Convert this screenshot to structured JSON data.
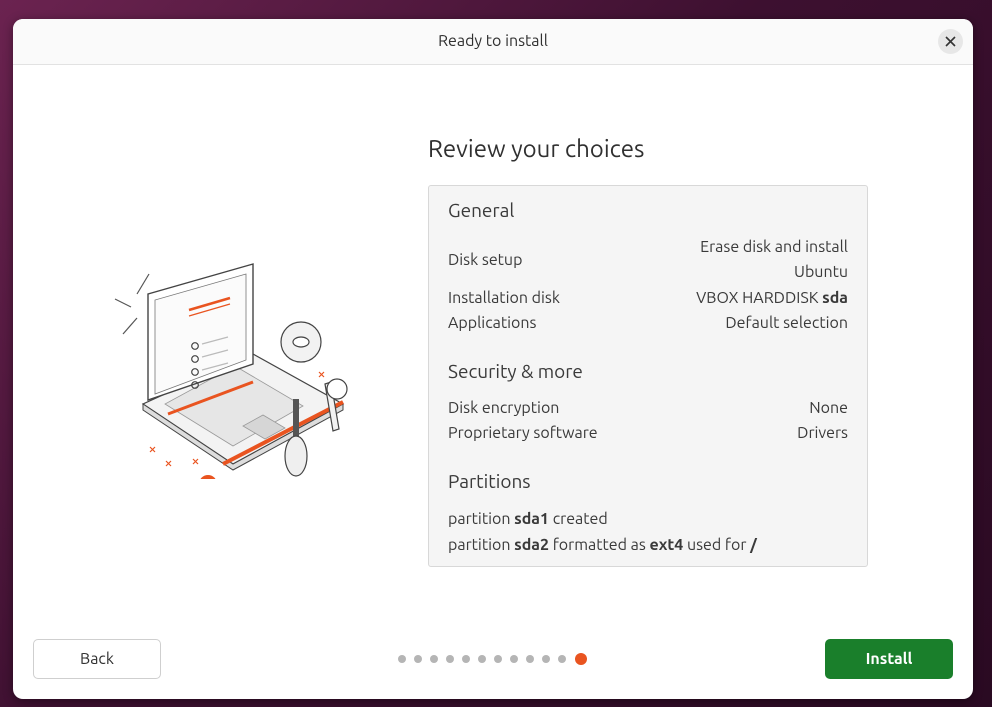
{
  "window": {
    "title": "Ready to install",
    "close_icon": "close-icon"
  },
  "heading": "Review your choices",
  "general": {
    "title": "General",
    "disk_setup_label": "Disk setup",
    "disk_setup_value_line1": "Erase disk and install",
    "disk_setup_value_line2": "Ubuntu",
    "installation_disk_label": "Installation disk",
    "installation_disk_value_prefix": "VBOX HARDDISK",
    "installation_disk_value_device": "sda",
    "applications_label": "Applications",
    "applications_value": "Default selection"
  },
  "security": {
    "title": "Security & more",
    "disk_encryption_label": "Disk encryption",
    "disk_encryption_value": "None",
    "proprietary_label": "Proprietary software",
    "proprietary_value": "Drivers"
  },
  "partitions": {
    "title": "Partitions",
    "line1": {
      "prefix": "partition",
      "device": "sda1",
      "suffix": "created"
    },
    "line2": {
      "prefix": "partition",
      "device": "sda2",
      "middle": "formatted as",
      "fs": "ext4",
      "used": "used for",
      "mount": "/"
    }
  },
  "buttons": {
    "back": "Back",
    "install": "Install"
  },
  "progress": {
    "total_steps": 12,
    "current_step": 12
  },
  "colors": {
    "accent": "#e95420",
    "install_button": "#1a7f2b"
  }
}
